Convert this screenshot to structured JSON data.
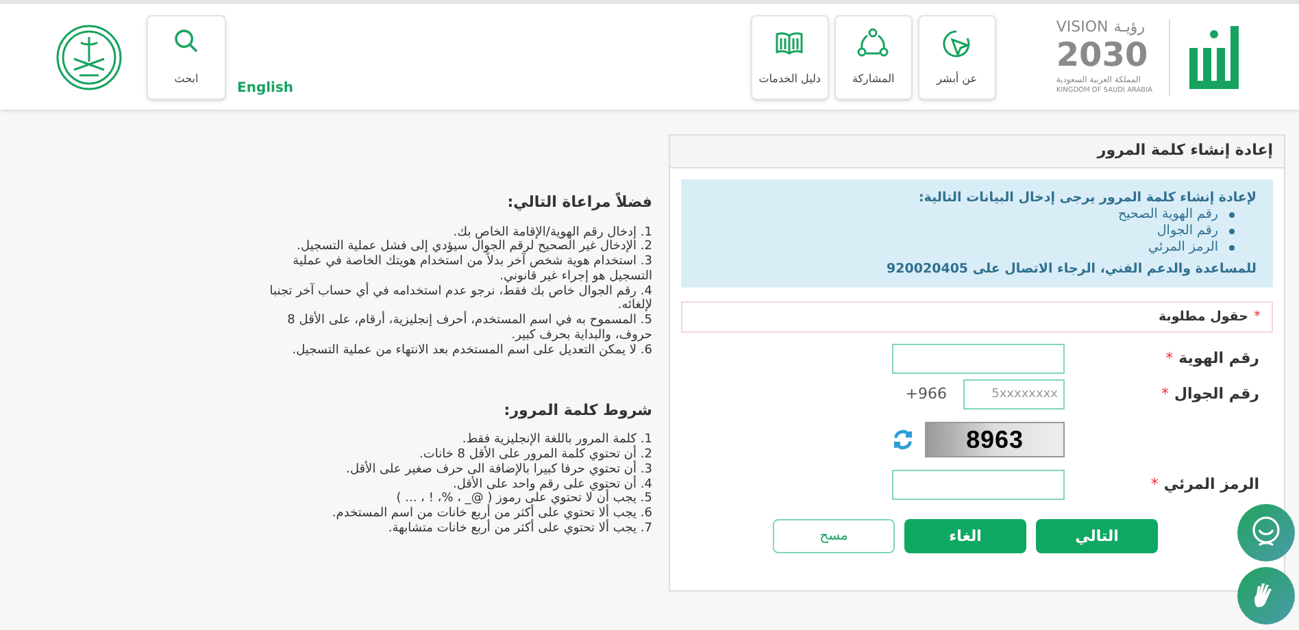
{
  "header": {
    "logo": {
      "vision": "VISION",
      "vision_ar": "رؤيـة",
      "year": "2030",
      "country_ar": "المملكة العربية السعودية",
      "country_en": "KINGDOM OF SAUDI ARABIA"
    },
    "nav": [
      {
        "label": "عن أبشر",
        "kind": "pointer"
      },
      {
        "label": "المشاركة",
        "kind": "share"
      },
      {
        "label": "دليل الخدمات",
        "kind": "book"
      }
    ],
    "language": "English",
    "search": "ابحث"
  },
  "notes": {
    "title": "فضلاً مراعاة التالي:",
    "items": [
      "1. إدخال رقم الهوية/الإقامة الخاص بك.",
      "2. الإدخال غير الصحيح لرقم الجوال سيؤدي إلى فشل عملية التسجيل.",
      "3. استخدام هوية شخص آخر بدلاً من استخدام هويتك الخاصة في عملية التسجيل هو إجراء غير قانوني.",
      "4. رقم الجوال خاص بك فقط، نرجو عدم استخدامه في أي حساب آخر تجنبا لإلغائه.",
      "5. المسموح به في اسم المستخدم، أحرف إنجليزية، أرقام، على الأقل 8 حروف، والبداية بحرف كبير.",
      "6. لا يمكن التعديل على اسم المستخدم بعد الانتهاء من عملية التسجيل."
    ]
  },
  "password_rules": {
    "title": "شروط كلمة المرور:",
    "items": [
      "1. كلمة المرور باللغة الإنجليزية فقط.",
      "2. أن تحتوي كلمة المرور على الأقل 8 خانات.",
      "3. أن تحتوي حرفا كبيرا بالإضافة الى حرف صغير على الأقل.",
      "4. أن تحتوي على رقم واحد على الأقل.",
      "5. يجب أن لا تحتوي على رموز ( @_ ، %، ! ، ... )",
      "6. يجب ألا تحتوي على أكثر من أربع خانات من اسم المستخدم.",
      "7. يجب ألا تحتوي على أكثر من أربع خانات متشابهة."
    ]
  },
  "form": {
    "title": "إعادة إنشاء كلمة المرور",
    "info": {
      "intro": "لإعادة إنشاء كلمة المرور يرجى إدخال البيانات التالية:",
      "items": [
        "رقم الهوية الصحيح",
        "رقم الجوال",
        "الرمز المرئي"
      ],
      "support": "للمساعدة والدعم الفني، الرجاء الاتصال على 920020405"
    },
    "required_mark": "*",
    "required_note": "حقول مطلوبة",
    "fields": [
      {
        "kind": "text",
        "label": "رقم الهوية",
        "required": true
      },
      {
        "kind": "phone",
        "label": "رقم الجوال",
        "required": true,
        "prefix": "+966",
        "placeholder": "5xxxxxxxx"
      },
      {
        "kind": "captcha",
        "code": "8963"
      },
      {
        "kind": "text",
        "label": "الرمز المرئي",
        "required": true
      }
    ],
    "buttons": [
      {
        "label": "التالي",
        "kind": "primary"
      },
      {
        "label": "الغاء",
        "kind": "primary"
      },
      {
        "label": "مسح",
        "kind": "outline"
      }
    ]
  }
}
